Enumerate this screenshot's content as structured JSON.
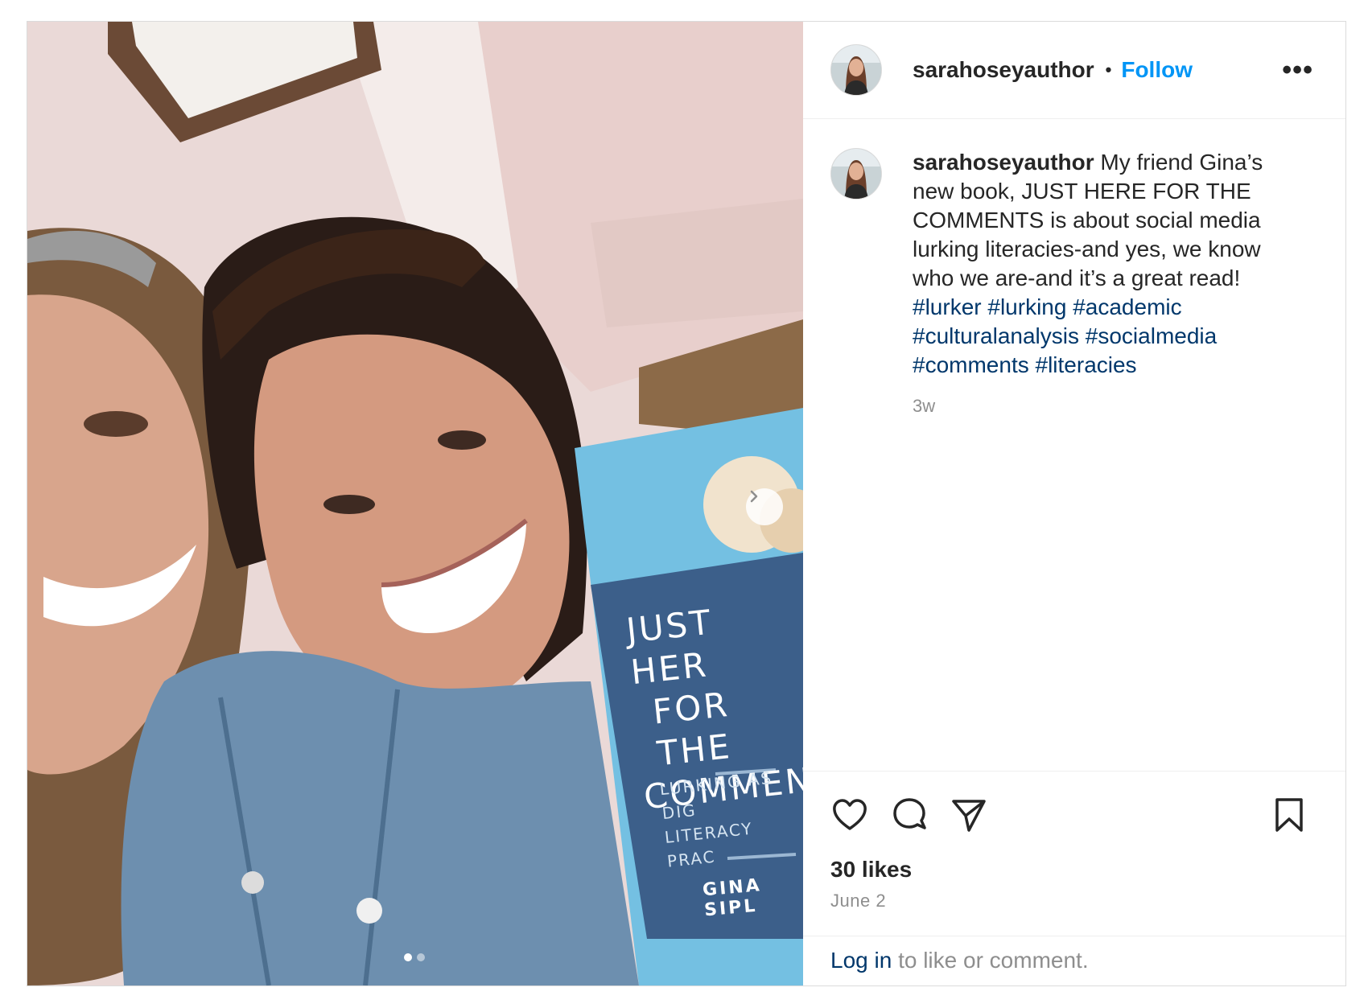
{
  "post": {
    "username": "sarahoseyauthor",
    "separator": "•",
    "follow_label": "Follow",
    "more_label": "•••",
    "caption": {
      "username": "sarahoseyauthor",
      "text_line1": "My friend Gina’s new book, JUST HERE FOR THE COMMENTS is about social media lurking literacies-and yes, we know who we are-and it’s a great read!",
      "hashtags": [
        "#lurker",
        "#lurking",
        "#academic",
        "#culturalanalysis",
        "#socialmedia",
        "#comments",
        "#literacies"
      ],
      "age": "3w"
    },
    "likes": "30 likes",
    "date": "June 2",
    "login_link": "Log in",
    "login_rest": " to like or comment."
  },
  "media": {
    "book_title_lines": [
      "JUST HER",
      "FOR THE",
      "COMMEN"
    ],
    "book_subtitle_lines": [
      "LURKING AS DIG",
      "LITERACY PRAC"
    ],
    "book_author": "GINA SIPL",
    "carousel_index": 1,
    "carousel_count": 2
  },
  "icons": {
    "heart": "heart-icon",
    "comment": "comment-icon",
    "share": "share-icon",
    "bookmark": "bookmark-icon",
    "next": "chevron-right-icon"
  },
  "colors": {
    "follow": "#0095f6",
    "link": "#00376b",
    "muted": "#8e8e8e",
    "text": "#262626",
    "book_blue": "#5fb0d8"
  }
}
